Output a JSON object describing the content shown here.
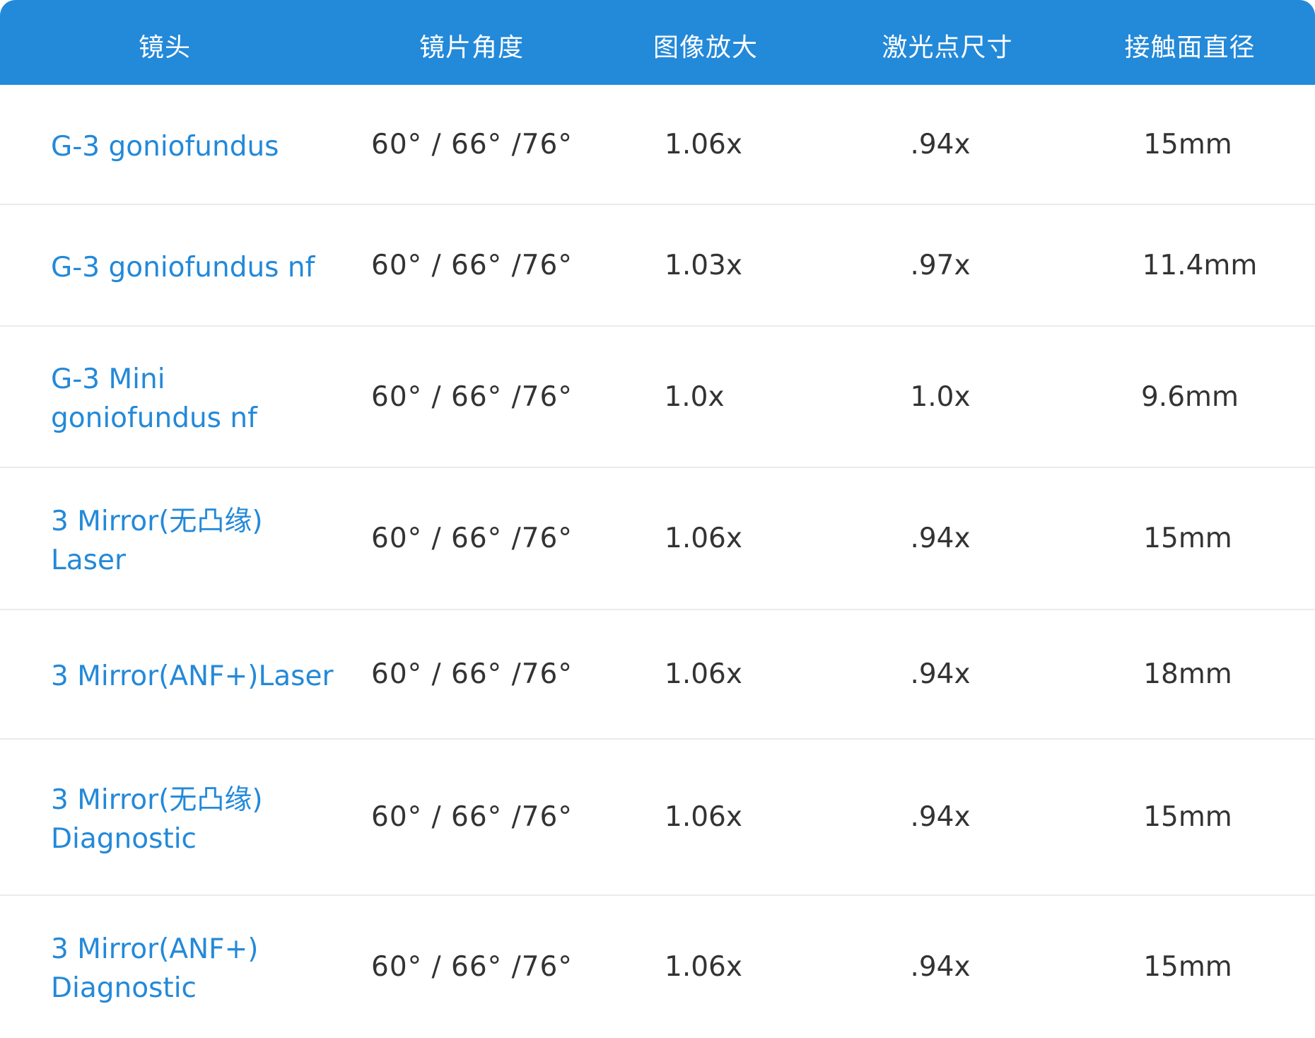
{
  "header": {
    "columns": [
      "镜头",
      "镜片角度",
      "图像放大",
      "激光点尺寸",
      "接触面直径"
    ]
  },
  "rows": [
    {
      "name": "G-3 goniofundus",
      "angle": "60° / 66° /76°",
      "image_mag": "1.06x",
      "laser_spot": ".94x",
      "contact_diameter": "15mm"
    },
    {
      "name": "G-3 goniofundus nf",
      "angle": "60° / 66° /76°",
      "image_mag": "1.03x",
      "laser_spot": ".97x",
      "contact_diameter": "11.4mm"
    },
    {
      "name": "G-3 Mini goniofundus nf",
      "angle": "60° / 66° /76°",
      "image_mag": "1.0x",
      "laser_spot": "1.0x",
      "contact_diameter": "9.6mm"
    },
    {
      "name": "3 Mirror(无凸缘) Laser",
      "angle": "60° / 66° /76°",
      "image_mag": "1.06x",
      "laser_spot": ".94x",
      "contact_diameter": "15mm"
    },
    {
      "name": "3 Mirror(ANF+)Laser",
      "angle": "60° / 66° /76°",
      "image_mag": "1.06x",
      "laser_spot": ".94x",
      "contact_diameter": "18mm"
    },
    {
      "name": "3 Mirror(无凸缘) Diagnostic",
      "angle": "60° / 66° /76°",
      "image_mag": "1.06x",
      "laser_spot": ".94x",
      "contact_diameter": "15mm"
    },
    {
      "name": "3 Mirror(ANF+) Diagnostic",
      "angle": "60° / 66° /76°",
      "image_mag": "1.06x",
      "laser_spot": ".94x",
      "contact_diameter": "15mm"
    }
  ],
  "colors": {
    "header_bg": "#2389d9",
    "header_text": "#ffffff",
    "name_text": "#2389d9",
    "value_text": "#333333",
    "divider": "#ebebeb"
  }
}
